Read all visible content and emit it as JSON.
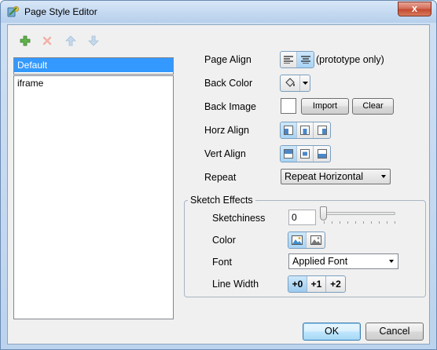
{
  "window": {
    "title": "Page Style Editor",
    "close_label": "x"
  },
  "toolbar": {
    "icons": [
      "add-icon",
      "remove-icon",
      "move-up-icon",
      "move-down-icon"
    ]
  },
  "styles_list": {
    "items": [
      {
        "label": "Default",
        "selected": true
      },
      {
        "label": "iframe",
        "selected": false
      }
    ]
  },
  "properties": {
    "page_align": {
      "label": "Page Align",
      "note": "(prototype only)"
    },
    "back_color": {
      "label": "Back Color"
    },
    "back_image": {
      "label": "Back Image",
      "import_label": "Import",
      "clear_label": "Clear"
    },
    "horz_align": {
      "label": "Horz Align"
    },
    "vert_align": {
      "label": "Vert Align"
    },
    "repeat": {
      "label": "Repeat",
      "value": "Repeat Horizontal"
    }
  },
  "sketch_effects": {
    "title": "Sketch Effects",
    "sketchiness": {
      "label": "Sketchiness",
      "value": "0"
    },
    "color": {
      "label": "Color"
    },
    "font": {
      "label": "Font",
      "value": "Applied Font"
    },
    "line_width": {
      "label": "Line Width",
      "options": [
        "+0",
        "+1",
        "+2"
      ]
    }
  },
  "footer": {
    "ok_label": "OK",
    "cancel_label": "Cancel"
  },
  "colors": {
    "selection": "#3399ff",
    "active_toggle": "#a8d4f4",
    "close_button": "#c44a31"
  }
}
